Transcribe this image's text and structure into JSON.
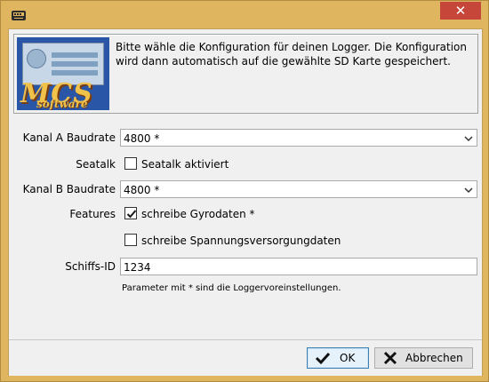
{
  "window": {
    "title": "",
    "close_symbol": "✕"
  },
  "header": {
    "logo_text": "MCS",
    "logo_subtext": "software",
    "description": "Bitte wähle die Konfiguration für deinen Logger. Die Konfiguration wird dann automatisch auf die gewählte SD Karte gespeichert."
  },
  "form": {
    "kanal_a": {
      "label": "Kanal A Baudrate",
      "value": "4800 *"
    },
    "seatalk": {
      "label": "Seatalk",
      "checkbox_label": "Seatalk aktiviert",
      "checked": false
    },
    "kanal_b": {
      "label": "Kanal B Baudrate",
      "value": "4800 *"
    },
    "features": {
      "label": "Features",
      "gyro": {
        "label": "schreibe Gyrodaten *",
        "checked": true
      },
      "power": {
        "label": "schreibe Spannungsversorgungdaten",
        "checked": false
      }
    },
    "schiffs_id": {
      "label": "Schiffs-ID",
      "value": "1234"
    },
    "note": "Parameter mit * sind die Loggervoreinstellungen."
  },
  "buttons": {
    "ok": {
      "label": "OK",
      "icon": "checkmark-icon"
    },
    "cancel": {
      "label": "Abbrechen",
      "icon": "x-icon"
    }
  }
}
